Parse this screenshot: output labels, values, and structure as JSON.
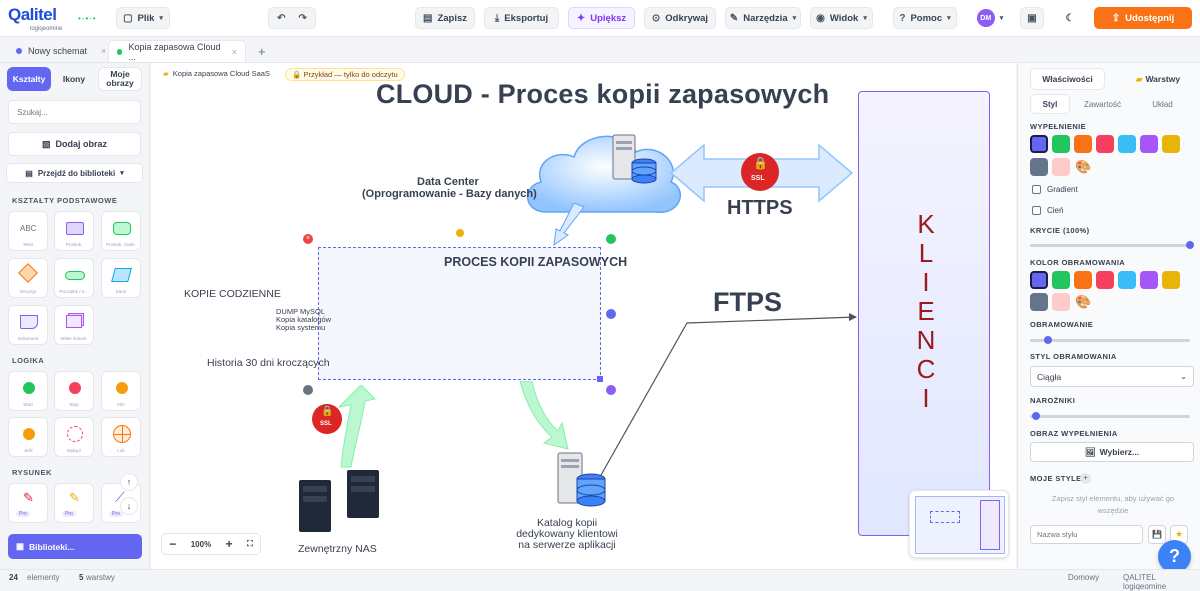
{
  "app": {
    "logo_text": "Qalitel",
    "logo_sub": "logiqeomine"
  },
  "toolbar": {
    "file": "Plik",
    "save": "Zapisz",
    "export": "Eksportuj",
    "beautify": "Upiększ",
    "unlink": "Odkrywaj",
    "tools": "Narzędzia",
    "view": "Widok",
    "help": "Pomoc",
    "avatar": "DM",
    "share": "Udostępnij"
  },
  "tabs": [
    {
      "label": "Nowy schemat",
      "dot": "#6366f1"
    },
    {
      "label": "Kopia zapasowa Cloud ...",
      "dot": "#22c55e"
    }
  ],
  "left": {
    "tabs": [
      "Kształty",
      "Ikony",
      "Moje obrazy"
    ],
    "search_placeholder": "Szukaj...",
    "add_image": "Dodaj obraz",
    "library": "Przejdź do biblioteki",
    "sections": {
      "basic": "KSZTAŁTY PODSTAWOWE",
      "logic": "LOGIKA",
      "drawing": "RYSUNEK"
    },
    "basic_shapes": [
      "Tekst",
      "Prostok.",
      "Prostok. zaokr.",
      "Decyzja",
      "Początek / K...",
      "Dane",
      "Dokument",
      "Wiele dokum."
    ],
    "logic_shapes": [
      "AND",
      "OR",
      "XOR",
      "NAND",
      "Zaokrąglij",
      "XOR (symbol)"
    ],
    "logic_labels": [
      "Start",
      "Stop",
      "Info",
      "Jeśli",
      "Wyłącz",
      "Lub"
    ],
    "drawing_shapes": [
      "Długopis",
      "Zakreślacz",
      "Strzałka"
    ],
    "pro_badge": "Pro",
    "libraries_button": "Biblioteki...",
    "zoom": "100%"
  },
  "breadcrumb": {
    "doc": "Kopia zapasowa Cloud SaaS",
    "badge": "Przykład — tylko do odczytu"
  },
  "diagram": {
    "title": "CLOUD - Proces kopii zapasowych",
    "data_center_1": "Data Center",
    "data_center_2": "(Oprogramowanie - Bazy danych)",
    "https": "HTTPS",
    "ftps": "FTPS",
    "ssl": "SSL",
    "klienci": [
      "K",
      "L",
      "I",
      "E",
      "N",
      "C",
      "I"
    ],
    "proces": "PROCES KOPII ZAPASOWYCH",
    "kopie": "KOPIE CODZIENNE",
    "dump_lines": [
      "DUMP MySQL",
      "Kopia katalogów",
      "Kopia systemu"
    ],
    "historia": "Historia 30 dni kroczących",
    "nas": "Zewnętrzny NAS",
    "katalog": [
      "Katalog kopii",
      "dedykowany klientowi",
      "na serwerze aplikacji"
    ]
  },
  "right": {
    "tabs": [
      "Właściwości",
      "Warstwy"
    ],
    "subtabs": [
      "Styl",
      "Zawartość",
      "Układ"
    ],
    "fill": "WYPEŁNIENIE",
    "gradient": "Gradient",
    "shadow": "Cień",
    "opacity": "KRYCIE (100%)",
    "border_color": "KOLOR OBRAMOWANIA",
    "border": "OBRAMOWANIE",
    "border_style": "STYL OBRAMOWANIA",
    "border_style_value": "Ciągła",
    "corners": "NAROŻNIKI",
    "fill_image": "OBRAZ WYPEŁNIENIA",
    "choose": "Wybierz...",
    "my_styles": "MOJE STYLE",
    "my_styles_hint": "Zapisz styl elementu, aby używać go wszędzie",
    "style_name_placeholder": "Nazwa stylu",
    "colors": [
      "#6366f1",
      "#22c55e",
      "#f97316",
      "#f43f5e",
      "#38bdf8",
      "#a855f7",
      "#eab308",
      "#64748b",
      "#fecaca"
    ],
    "opacity_value": 1.0
  },
  "status": {
    "elements_count": "24",
    "elements_label": "elementy",
    "layers_count": "5",
    "layers_label": "warstwy",
    "theme": "Domowy",
    "brand": "QALITEL logiqeomine"
  }
}
